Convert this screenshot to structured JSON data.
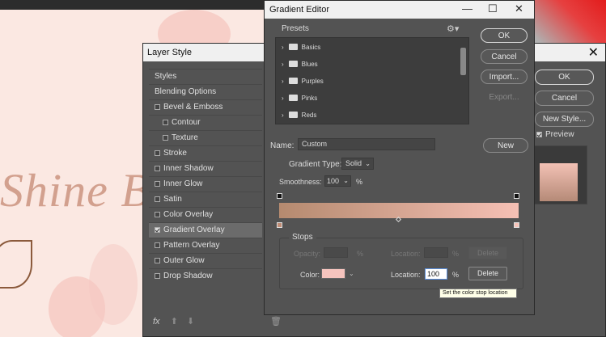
{
  "layer_style": {
    "title": "Layer Style",
    "close": "✕",
    "items": [
      {
        "label": "Styles",
        "checkbox": false
      },
      {
        "label": "Blending Options",
        "checkbox": false
      },
      {
        "label": "Bevel & Emboss",
        "checkbox": true,
        "checked": false
      },
      {
        "label": "Contour",
        "checkbox": true,
        "checked": false,
        "sub": true
      },
      {
        "label": "Texture",
        "checkbox": true,
        "checked": false,
        "sub": true
      },
      {
        "label": "Stroke",
        "checkbox": true,
        "checked": false
      },
      {
        "label": "Inner Shadow",
        "checkbox": true,
        "checked": false
      },
      {
        "label": "Inner Glow",
        "checkbox": true,
        "checked": false
      },
      {
        "label": "Satin",
        "checkbox": true,
        "checked": false
      },
      {
        "label": "Color Overlay",
        "checkbox": true,
        "checked": false
      },
      {
        "label": "Gradient Overlay",
        "checkbox": true,
        "checked": true,
        "selected": true
      },
      {
        "label": "Pattern Overlay",
        "checkbox": true,
        "checked": false
      },
      {
        "label": "Outer Glow",
        "checkbox": true,
        "checked": false
      },
      {
        "label": "Drop Shadow",
        "checkbox": true,
        "checked": false
      }
    ],
    "ok_label": "OK",
    "cancel_label": "Cancel",
    "new_style_label": "New Style...",
    "preview_label": "Preview",
    "preview_checked": true,
    "footer_fx": "fx",
    "footer_icons": [
      "arrow-up-icon",
      "arrow-down-icon",
      "trash-icon"
    ]
  },
  "canvas": {
    "text": "Shine B",
    "colors": {
      "artboard": "#fbe8e2",
      "text": "#d2a08e"
    }
  },
  "gradient_editor": {
    "title": "Gradient Editor",
    "window_controls": [
      "—",
      "☐",
      "✕"
    ],
    "presets_label": "Presets",
    "presets": [
      "Basics",
      "Blues",
      "Purples",
      "Pinks",
      "Reds"
    ],
    "ok_label": "OK",
    "cancel_label": "Cancel",
    "import_label": "Import...",
    "export_label": "Export...",
    "name_label": "Name:",
    "name_value": "Custom",
    "new_label": "New",
    "gradient_type_label": "Gradient Type:",
    "gradient_type_value": "Solid",
    "smoothness_label": "Smoothness:",
    "smoothness_value": "100",
    "percent": "%",
    "gradient_colors": {
      "start": "#b58a6f",
      "end": "#f6c0b5"
    },
    "stops_label": "Stops",
    "opacity_label": "Opacity:",
    "location_label": "Location:",
    "delete_label": "Delete",
    "color_label": "Color:",
    "color_value": "#f6c4be",
    "location_value": "100",
    "tooltip": "Set the color stop location"
  }
}
